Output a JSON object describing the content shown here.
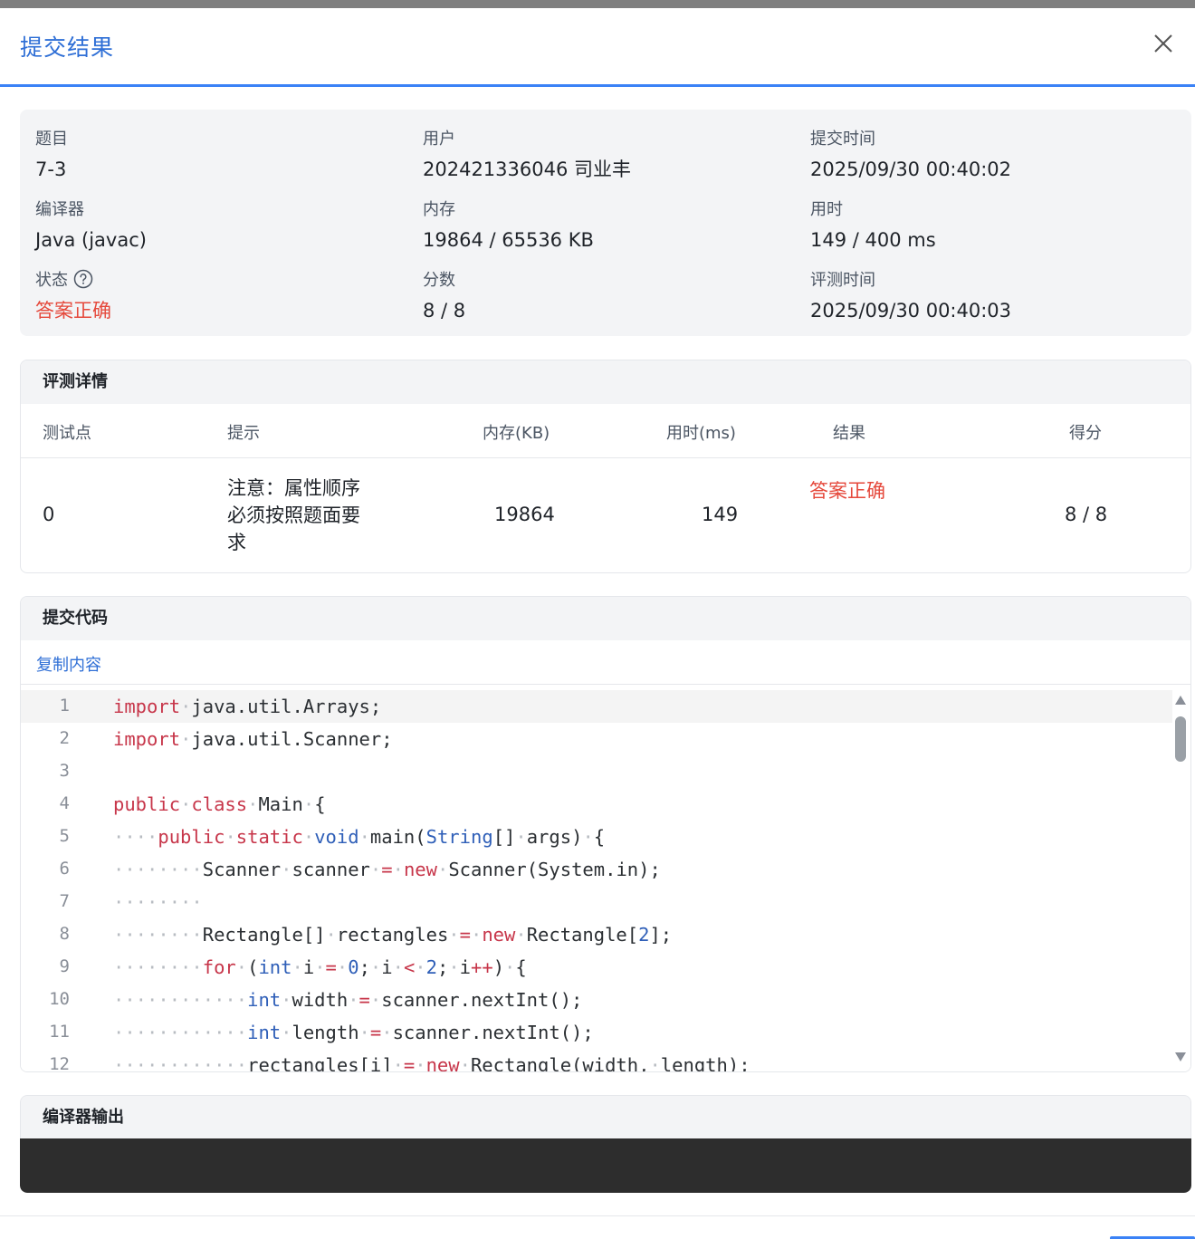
{
  "dialog": {
    "title": "提交结果"
  },
  "info": {
    "problem_label": "题目",
    "problem_value": "7-3",
    "user_label": "用户",
    "user_value": "202421336046 司业丰",
    "submit_time_label": "提交时间",
    "submit_time_value": "2025/09/30 00:40:02",
    "compiler_label": "编译器",
    "compiler_value": "Java (javac)",
    "memory_label": "内存",
    "memory_value": "19864 / 65536 KB",
    "time_label": "用时",
    "time_value": "149 / 400 ms",
    "status_label": "状态",
    "status_value": "答案正确",
    "score_label": "分数",
    "score_value": "8 / 8",
    "judge_time_label": "评测时间",
    "judge_time_value": "2025/09/30 00:40:03"
  },
  "judge": {
    "title": "评测详情",
    "headers": {
      "case": "测试点",
      "hint": "提示",
      "memory": "内存(KB)",
      "time": "用时(ms)",
      "result": "结果",
      "score": "得分"
    },
    "rows": [
      {
        "case": "0",
        "hint": "注意：属性顺序必须按照题面要求",
        "memory": "19864",
        "time": "149",
        "result": "答案正确",
        "score": "8 / 8"
      }
    ]
  },
  "code": {
    "title": "提交代码",
    "copy_label": "复制内容",
    "line_numbers": [
      "1",
      "2",
      "3",
      "4",
      "5",
      "6",
      "7",
      "8",
      "9",
      "10",
      "11",
      "12"
    ]
  },
  "compiler_output": {
    "title": "编译器输出",
    "text": ""
  },
  "colors": {
    "accent": "#2f6fd6",
    "success_text": "#e5483b",
    "keyword": "#c7364a",
    "type": "#2f5fb8"
  },
  "icons": {
    "close": "close-icon",
    "help": "help-circle-icon",
    "scroll_up": "triangle-up-icon",
    "scroll_down": "triangle-down-icon"
  }
}
